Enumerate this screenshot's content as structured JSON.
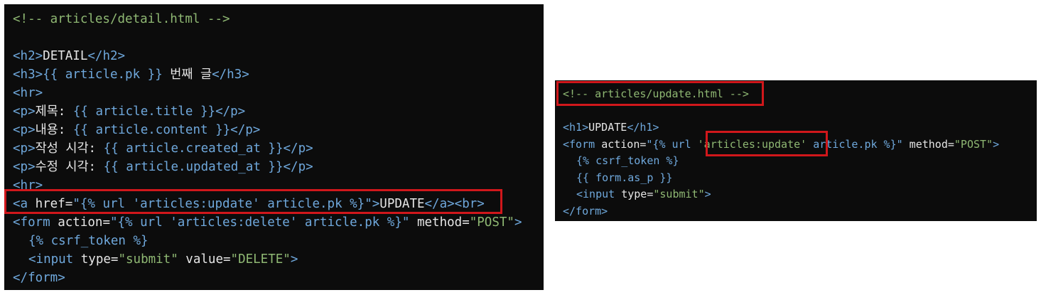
{
  "left_panel": {
    "comment": "<!-- articles/detail.html -->",
    "h2_open": "<h2>",
    "h2_text": "DETAIL",
    "h2_close": "</h2>",
    "h3_open": "<h3>",
    "h3_tmpl": "{{ article.pk }}",
    "h3_text": " 번째 글",
    "h3_close": "</h3>",
    "hr": "<hr>",
    "p_open": "<p>",
    "p_close": "</p>",
    "title_label": "제목: ",
    "title_tmpl": "{{ article.title }}",
    "content_label": "내용: ",
    "content_tmpl": "{{ article.content }}",
    "created_label": "작성 시각: ",
    "created_tmpl": "{{ article.created_at }}",
    "updated_label": "수정 시각: ",
    "updated_tmpl": "{{ article.updated_at }}",
    "a_open": "<a ",
    "a_attr": "href",
    "eq": "=",
    "a_href_value": "\"{% url 'articles:update' article.pk %}\"",
    "a_gt": ">",
    "a_text": "UPDATE",
    "a_close": "</a>",
    "br": "<br>",
    "form_open": "<form ",
    "form_attr_action": "action",
    "form_action_value": "\"{% url 'articles:delete' article.pk %}\"",
    "form_attr_method": " method",
    "form_method_value": "\"POST\"",
    "form_gt": ">",
    "csrf": "{% csrf_token %}",
    "input_open": "<input ",
    "input_attr_type": "type",
    "input_type_value": "\"submit\"",
    "input_attr_value": " value",
    "input_value_value": "\"DELETE\"",
    "input_gt": ">",
    "form_close": "</form>"
  },
  "right_panel": {
    "comment": "<!-- articles/update.html -->",
    "h1_open": "<h1>",
    "h1_text": "UPDATE",
    "h1_close": "</h1>",
    "form_open": "<form ",
    "form_attr_action": "action",
    "eq": "=",
    "action_q": "\"",
    "action_tmpl_start": "{% url ",
    "action_name": "'articles:update'",
    "action_tmpl_end": " article.pk %}",
    "form_attr_method": " method",
    "form_method_value": "\"POST\"",
    "form_gt": ">",
    "csrf": "{% csrf_token %}",
    "form_as_p": "{{ form.as_p }}",
    "input_open": "<input ",
    "input_attr_type": "type",
    "input_type_value": "\"submit\"",
    "input_gt": ">",
    "form_close": "</form>"
  },
  "colors": {
    "background": "#0c0c0c",
    "comment": "#8fb873",
    "tag": "#6fa8dc",
    "highlight": "#d0171b"
  }
}
